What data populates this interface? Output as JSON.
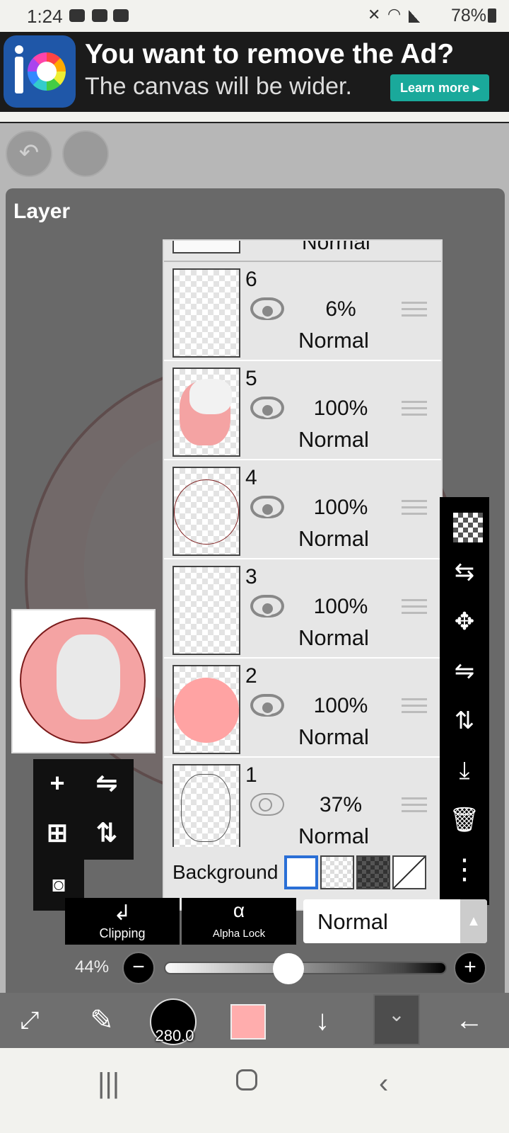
{
  "status_bar": {
    "time": "1:24",
    "battery": "78%",
    "notification_icons": [
      "youtube-icon",
      "check-icon",
      "gallery-icon"
    ],
    "system_icons": [
      "mute-icon",
      "wifi-icon",
      "signal-icon",
      "battery-icon"
    ]
  },
  "ad": {
    "headline": "You want to remove the Ad?",
    "subtext": "The canvas will be wider.",
    "cta": "Learn more ▸"
  },
  "panel": {
    "title": "Layer"
  },
  "layers_partial_top": {
    "blend": "Normal"
  },
  "layers": [
    {
      "number": "6",
      "opacity": "6%",
      "blend": "Normal",
      "visible": true
    },
    {
      "number": "5",
      "opacity": "100%",
      "blend": "Normal",
      "visible": true
    },
    {
      "number": "4",
      "opacity": "100%",
      "blend": "Normal",
      "visible": true
    },
    {
      "number": "3",
      "opacity": "100%",
      "blend": "Normal",
      "visible": true
    },
    {
      "number": "2",
      "opacity": "100%",
      "blend": "Normal",
      "visible": true
    },
    {
      "number": "1",
      "opacity": "37%",
      "blend": "Normal",
      "visible": false
    }
  ],
  "background_row": {
    "label": "Background",
    "selected": "white"
  },
  "controls": {
    "clipping": "Clipping",
    "alpha_lock": "Alpha Lock",
    "alpha_lock_glyph": "α",
    "blend_mode": "Normal"
  },
  "opacity_slider": {
    "label": "44%",
    "value": 0.44
  },
  "bottom_bar": {
    "brush_size": "280.0"
  },
  "colors": {
    "current_color": "#ffadad",
    "ad_button": "#1aa99b",
    "artwork_outline": "#7a1a1a"
  }
}
